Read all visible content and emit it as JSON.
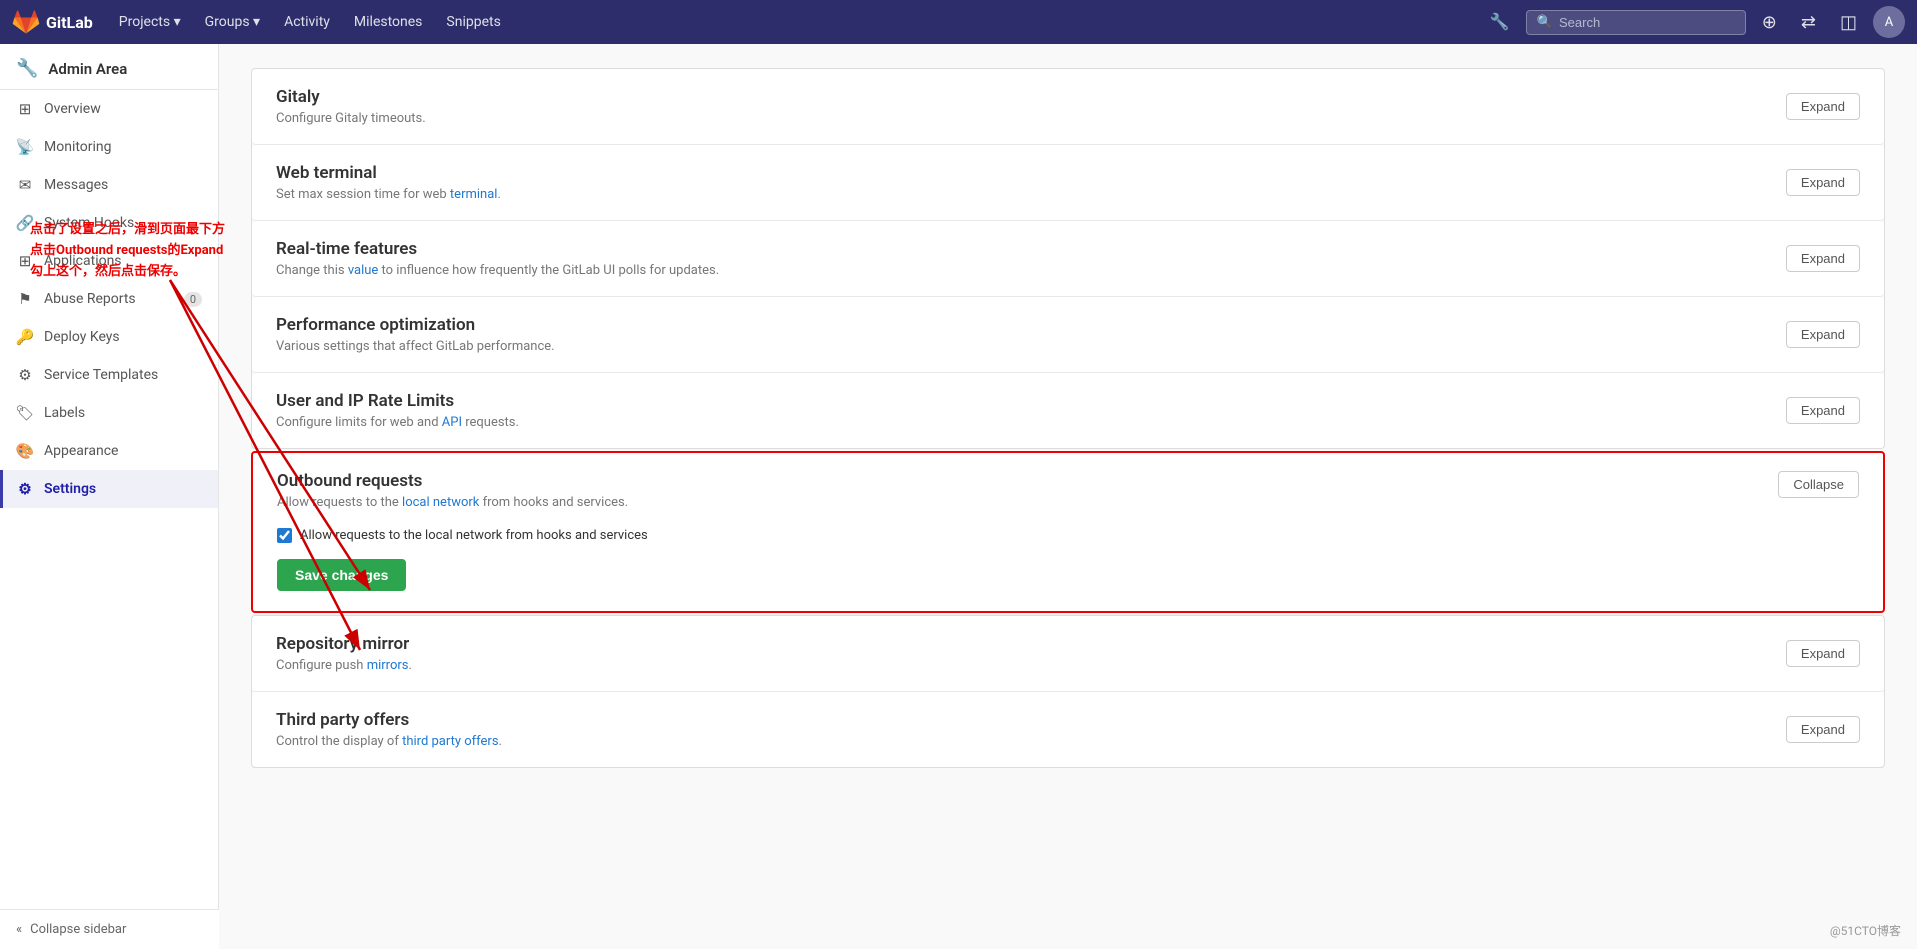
{
  "navbar": {
    "brand": "GitLab",
    "nav_items": [
      {
        "label": "Projects",
        "has_dropdown": true
      },
      {
        "label": "Groups",
        "has_dropdown": true
      },
      {
        "label": "Activity",
        "has_dropdown": false
      },
      {
        "label": "Milestones",
        "has_dropdown": false
      },
      {
        "label": "Snippets",
        "has_dropdown": false
      }
    ],
    "search_placeholder": "Search",
    "plus_icon": "+",
    "wrench_icon": "🔧"
  },
  "sidebar": {
    "header": "Admin Area",
    "items": [
      {
        "id": "overview",
        "label": "Overview",
        "icon": "⊞",
        "active": false
      },
      {
        "id": "monitoring",
        "label": "Monitoring",
        "icon": "📊",
        "active": false
      },
      {
        "id": "messages",
        "label": "Messages",
        "icon": "💬",
        "active": false
      },
      {
        "id": "system-hooks",
        "label": "System Hooks",
        "icon": "🔗",
        "active": false
      },
      {
        "id": "applications",
        "label": "Applications",
        "icon": "⊞",
        "active": false
      },
      {
        "id": "abuse-reports",
        "label": "Abuse Reports",
        "icon": "⚑",
        "active": false,
        "badge": "0"
      },
      {
        "id": "deploy-keys",
        "label": "Deploy Keys",
        "icon": "🔑",
        "active": false
      },
      {
        "id": "service-templates",
        "label": "Service Templates",
        "icon": "⚙",
        "active": false
      },
      {
        "id": "labels",
        "label": "Labels",
        "icon": "🏷",
        "active": false
      },
      {
        "id": "appearance",
        "label": "Appearance",
        "icon": "🎨",
        "active": false
      },
      {
        "id": "settings",
        "label": "Settings",
        "icon": "⚙",
        "active": true
      }
    ],
    "collapse_label": "Collapse sidebar"
  },
  "annotation": {
    "text": "点击了设置之后，滑到页面最下方\n点击Outbound requests的Expand\n勾上这个，然后点击保存。"
  },
  "sections": [
    {
      "id": "gitaly",
      "title": "Gitaly",
      "description": "Configure Gitaly timeouts.",
      "description_links": [],
      "expanded": false,
      "button_label": "Expand"
    },
    {
      "id": "web-terminal",
      "title": "Web terminal",
      "description": "Set max session time for web terminal.",
      "description_links": [
        {
          "text": "terminal",
          "href": "#"
        }
      ],
      "expanded": false,
      "button_label": "Expand"
    },
    {
      "id": "realtime-features",
      "title": "Real-time features",
      "description": "Change this value to influence how frequently the GitLab UI polls for updates.",
      "description_links": [
        {
          "text": "value",
          "href": "#"
        }
      ],
      "expanded": false,
      "button_label": "Expand"
    },
    {
      "id": "performance-optimization",
      "title": "Performance optimization",
      "description": "Various settings that affect GitLab performance.",
      "description_links": [],
      "expanded": false,
      "button_label": "Expand"
    },
    {
      "id": "user-ip-rate-limits",
      "title": "User and IP Rate Limits",
      "description": "Configure limits for web and API requests.",
      "description_links": [
        {
          "text": "API",
          "href": "#"
        }
      ],
      "expanded": false,
      "button_label": "Expand"
    }
  ],
  "outbound_section": {
    "id": "outbound-requests",
    "title": "Outbound requests",
    "description": "Allow requests to the local network from hooks and services.",
    "description_links": [
      {
        "text": "local network",
        "href": "#"
      }
    ],
    "expanded": true,
    "button_label": "Collapse",
    "checkbox_label": "Allow requests to the local network from hooks and services",
    "checkbox_checked": true,
    "save_button_label": "Save changes"
  },
  "bottom_sections": [
    {
      "id": "repository-mirror",
      "title": "Repository mirror",
      "description": "Configure push mirrors.",
      "description_links": [
        {
          "text": "mirrors",
          "href": "#"
        }
      ],
      "expanded": false,
      "button_label": "Expand"
    },
    {
      "id": "third-party-offers",
      "title": "Third party offers",
      "description": "Control the display of third party offers.",
      "description_links": [
        {
          "text": "third party offers",
          "href": "#"
        }
      ],
      "expanded": false,
      "button_label": "Expand"
    }
  ],
  "footer": {
    "note": "@51CTO博客"
  }
}
